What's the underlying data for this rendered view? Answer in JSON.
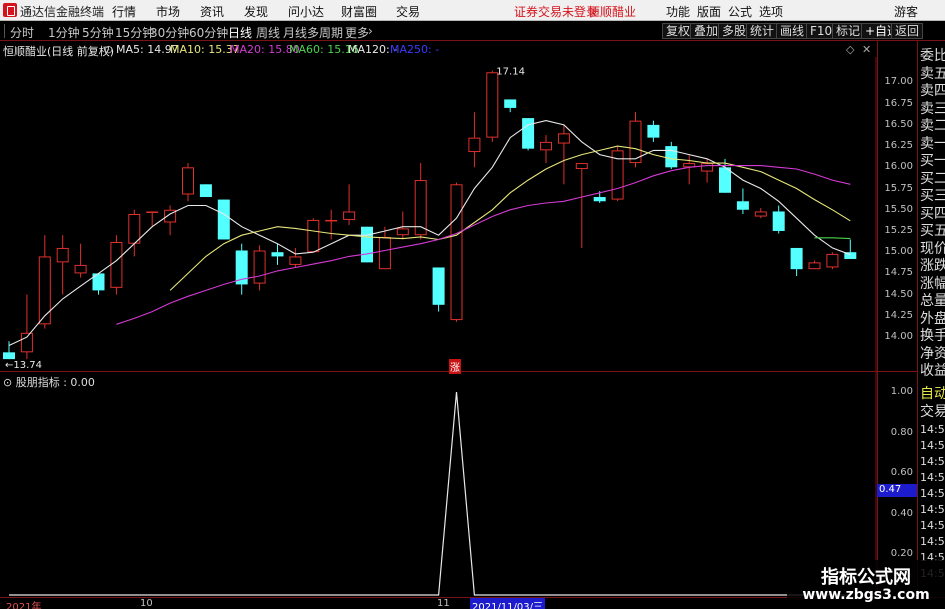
{
  "app": {
    "title": "通达信金融终端",
    "menu": [
      "行情",
      "市场",
      "资讯",
      "发现",
      "问小达",
      "财富圈",
      "交易"
    ],
    "status": "证券交易未登录",
    "stock_name": "恒顺醋业",
    "right_menu": [
      "功能",
      "版面",
      "公式",
      "选项"
    ],
    "guest": "游客"
  },
  "toolbar": {
    "periods": [
      "分时",
      "1分钟",
      "5分钟",
      "15分钟",
      "30分钟",
      "60分钟",
      "日线",
      "周线",
      "月线",
      "多周期",
      "更多"
    ],
    "active_period": "日线",
    "more_arrow": "›",
    "buttons": [
      "复权",
      "叠加",
      "多股",
      "统计",
      "画线",
      "F10",
      "标记",
      "+自选",
      "返回"
    ]
  },
  "indicator_line": {
    "title": "恒顺醋业(日线 前复权)",
    "ma5": "MA5: 14.97",
    "ma10": "MA10: 15.37",
    "ma20": "MA20: 15.80",
    "ma60": "MA60: 15.16",
    "ma120": "MA120: -",
    "ma250": "MA250: -"
  },
  "colors": {
    "up": "#e0302c",
    "down": "#54ffff",
    "ma5": "#e8e8e8",
    "ma10": "#e6e67a",
    "ma20": "#d43ad4",
    "ma60": "#4ad44a",
    "grid": "#7a1414"
  },
  "main_axis": [
    "17.00",
    "16.75",
    "16.50",
    "16.25",
    "16.00",
    "15.75",
    "15.50",
    "15.25",
    "15.00",
    "14.75",
    "14.50",
    "14.25",
    "14.00"
  ],
  "annotations": {
    "high": "17.14",
    "low": "13.74",
    "zhang": "涨"
  },
  "sub_indicator": {
    "title": "股朋指标 : 0.00",
    "axis": [
      "1.00",
      "0.80",
      "0.60",
      "0.40",
      "0.20"
    ],
    "cursor_value": "0.47"
  },
  "side_panel": {
    "labels": [
      "委比",
      "卖五",
      "卖四",
      "卖三",
      "卖二",
      "卖一",
      "买一",
      "买二",
      "买三",
      "买四",
      "买五",
      "现价",
      "涨跌",
      "涨幅",
      "总量",
      "外盘",
      "换手",
      "净资",
      "收益"
    ],
    "sub_labels": [
      "自动",
      "交易"
    ],
    "times": [
      "14:5",
      "14:5",
      "14:5",
      "14:5",
      "14:5",
      "14:5",
      "14:5",
      "14:5",
      "14:5",
      "14:5"
    ]
  },
  "date_axis": {
    "labels": [
      "2021年",
      "10",
      "11"
    ],
    "cursor_date": "2021/11/03/三"
  },
  "watermark": {
    "line1": "指标公式网",
    "line2": "www.zbgs3.com"
  },
  "chart_data": {
    "type": "candlestick",
    "ylim": [
      13.6,
      17.3
    ],
    "candles": [
      {
        "o": 13.82,
        "h": 13.95,
        "l": 13.74,
        "c": 13.74
      },
      {
        "o": 13.82,
        "h": 14.5,
        "l": 13.74,
        "c": 14.05
      },
      {
        "o": 14.15,
        "h": 15.2,
        "l": 14.1,
        "c": 14.95
      },
      {
        "o": 14.88,
        "h": 15.2,
        "l": 14.5,
        "c": 15.05
      },
      {
        "o": 14.75,
        "h": 15.1,
        "l": 14.7,
        "c": 14.85
      },
      {
        "o": 14.75,
        "h": 14.75,
        "l": 14.5,
        "c": 14.55
      },
      {
        "o": 14.58,
        "h": 15.2,
        "l": 14.5,
        "c": 15.12
      },
      {
        "o": 15.1,
        "h": 15.5,
        "l": 14.95,
        "c": 15.45
      },
      {
        "o": 15.48,
        "h": 15.48,
        "l": 15.3,
        "c": 15.48
      },
      {
        "o": 15.35,
        "h": 15.55,
        "l": 15.2,
        "c": 15.5
      },
      {
        "o": 15.68,
        "h": 16.05,
        "l": 15.6,
        "c": 16.0
      },
      {
        "o": 15.8,
        "h": 15.8,
        "l": 15.65,
        "c": 15.65
      },
      {
        "o": 15.62,
        "h": 15.62,
        "l": 15.15,
        "c": 15.15
      },
      {
        "o": 15.02,
        "h": 15.1,
        "l": 14.5,
        "c": 14.62
      },
      {
        "o": 14.63,
        "h": 15.08,
        "l": 14.55,
        "c": 15.02
      },
      {
        "o": 15.0,
        "h": 15.1,
        "l": 14.85,
        "c": 14.95
      },
      {
        "o": 14.85,
        "h": 15.05,
        "l": 14.82,
        "c": 14.95
      },
      {
        "o": 15.0,
        "h": 15.4,
        "l": 15.0,
        "c": 15.38
      },
      {
        "o": 15.38,
        "h": 15.5,
        "l": 15.15,
        "c": 15.38
      },
      {
        "o": 15.38,
        "h": 15.8,
        "l": 15.32,
        "c": 15.48
      },
      {
        "o": 15.3,
        "h": 15.3,
        "l": 14.88,
        "c": 14.88
      },
      {
        "o": 14.8,
        "h": 15.3,
        "l": 14.8,
        "c": 15.18
      },
      {
        "o": 15.2,
        "h": 15.48,
        "l": 15.15,
        "c": 15.28
      },
      {
        "o": 15.2,
        "h": 16.05,
        "l": 15.15,
        "c": 15.85
      },
      {
        "o": 14.82,
        "h": 14.82,
        "l": 14.3,
        "c": 14.38
      },
      {
        "o": 14.2,
        "h": 15.82,
        "l": 14.18,
        "c": 15.8
      },
      {
        "o": 16.18,
        "h": 16.65,
        "l": 16.0,
        "c": 16.35
      },
      {
        "o": 16.35,
        "h": 17.14,
        "l": 16.3,
        "c": 17.12
      },
      {
        "o": 16.8,
        "h": 16.8,
        "l": 16.65,
        "c": 16.7
      },
      {
        "o": 16.58,
        "h": 16.58,
        "l": 16.2,
        "c": 16.22
      },
      {
        "o": 16.2,
        "h": 16.38,
        "l": 16.05,
        "c": 16.3
      },
      {
        "o": 16.28,
        "h": 16.5,
        "l": 15.8,
        "c": 16.4
      },
      {
        "o": 15.98,
        "h": 16.05,
        "l": 15.05,
        "c": 16.05
      },
      {
        "o": 15.65,
        "h": 15.72,
        "l": 15.58,
        "c": 15.6
      },
      {
        "o": 15.62,
        "h": 16.25,
        "l": 15.6,
        "c": 16.2
      },
      {
        "o": 16.05,
        "h": 16.65,
        "l": 16.0,
        "c": 16.55
      },
      {
        "o": 16.5,
        "h": 16.55,
        "l": 16.3,
        "c": 16.35
      },
      {
        "o": 16.25,
        "h": 16.3,
        "l": 15.98,
        "c": 16.0
      },
      {
        "o": 16.0,
        "h": 16.15,
        "l": 15.8,
        "c": 16.05
      },
      {
        "o": 15.95,
        "h": 16.1,
        "l": 15.82,
        "c": 16.05
      },
      {
        "o": 16.0,
        "h": 16.1,
        "l": 15.7,
        "c": 15.7
      },
      {
        "o": 15.6,
        "h": 15.75,
        "l": 15.45,
        "c": 15.5
      },
      {
        "o": 15.42,
        "h": 15.52,
        "l": 15.4,
        "c": 15.48
      },
      {
        "o": 15.48,
        "h": 15.55,
        "l": 15.22,
        "c": 15.25
      },
      {
        "o": 15.05,
        "h": 15.05,
        "l": 14.72,
        "c": 14.8
      },
      {
        "o": 14.8,
        "h": 14.9,
        "l": 14.8,
        "c": 14.88
      },
      {
        "o": 14.82,
        "h": 15.0,
        "l": 14.8,
        "c": 14.98
      },
      {
        "o": 15.0,
        "h": 15.15,
        "l": 14.92,
        "c": 14.92
      }
    ],
    "ma5": [
      13.9,
      14.0,
      14.25,
      14.45,
      14.6,
      14.75,
      14.9,
      15.1,
      15.3,
      15.45,
      15.55,
      15.55,
      15.45,
      15.3,
      15.2,
      15.1,
      14.98,
      15.0,
      15.1,
      15.2,
      15.2,
      15.25,
      15.3,
      15.3,
      15.2,
      15.4,
      15.75,
      16.0,
      16.35,
      16.5,
      16.55,
      16.5,
      16.3,
      16.15,
      16.1,
      16.1,
      16.2,
      16.2,
      16.15,
      16.1,
      16.0,
      15.85,
      15.75,
      15.6,
      15.4,
      15.2,
      15.05,
      14.97
    ],
    "ma10": [
      null,
      null,
      null,
      null,
      null,
      null,
      null,
      null,
      null,
      14.55,
      14.75,
      14.95,
      15.1,
      15.2,
      15.25,
      15.3,
      15.28,
      15.25,
      15.22,
      15.2,
      15.18,
      15.17,
      15.16,
      15.18,
      15.15,
      15.2,
      15.35,
      15.5,
      15.7,
      15.85,
      15.98,
      16.08,
      16.15,
      16.2,
      16.25,
      16.22,
      16.15,
      16.1,
      16.08,
      16.05,
      16.05,
      16.0,
      15.95,
      15.85,
      15.75,
      15.62,
      15.5,
      15.37
    ],
    "ma20": [
      null,
      null,
      null,
      null,
      null,
      null,
      14.15,
      14.22,
      14.3,
      14.4,
      14.48,
      14.55,
      14.62,
      14.68,
      14.72,
      14.78,
      14.82,
      14.86,
      14.9,
      14.95,
      14.98,
      15.02,
      15.06,
      15.1,
      15.15,
      15.22,
      15.32,
      15.42,
      15.5,
      15.55,
      15.58,
      15.6,
      15.65,
      15.7,
      15.75,
      15.82,
      15.9,
      15.96,
      16.0,
      16.02,
      16.02,
      16.02,
      16.02,
      16.0,
      15.98,
      15.92,
      15.85,
      15.8
    ],
    "ma60": [
      null,
      null,
      null,
      null,
      null,
      null,
      null,
      null,
      null,
      null,
      null,
      null,
      null,
      null,
      null,
      null,
      null,
      null,
      null,
      null,
      null,
      null,
      null,
      null,
      null,
      null,
      null,
      null,
      null,
      null,
      null,
      null,
      null,
      null,
      null,
      null,
      null,
      null,
      null,
      null,
      null,
      null,
      null,
      null,
      null,
      15.17,
      15.17,
      15.16
    ],
    "sub_values": [
      0,
      0,
      0,
      0,
      0,
      0,
      0,
      0,
      0,
      0,
      0,
      0,
      0,
      0,
      0,
      0,
      0,
      0,
      0,
      0,
      0,
      0,
      0,
      0,
      0,
      1.0,
      0,
      0,
      0,
      0,
      0,
      0,
      0,
      0,
      0,
      0,
      0,
      0,
      0,
      0,
      0,
      0,
      0,
      0,
      0,
      0,
      0,
      0
    ],
    "sub_ylim": [
      0,
      1.05
    ]
  }
}
